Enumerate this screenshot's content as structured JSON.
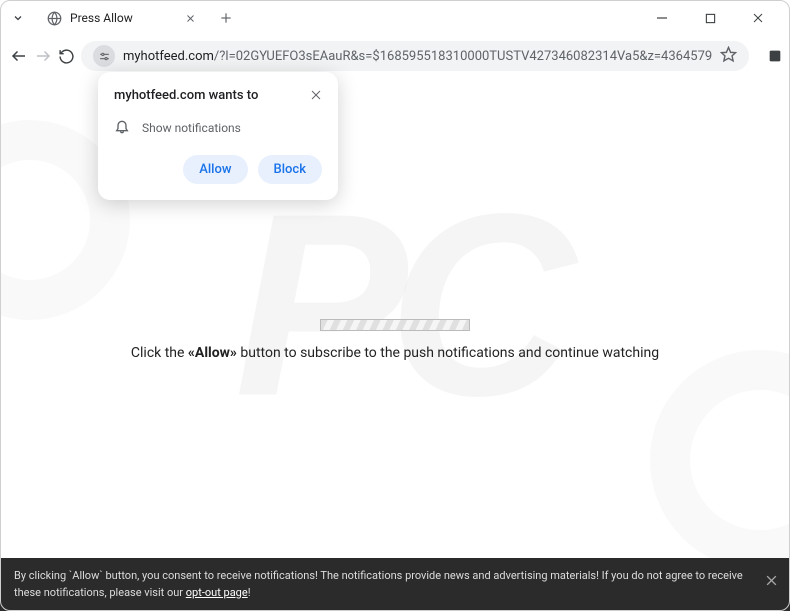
{
  "tab": {
    "title": "Press Allow"
  },
  "url": {
    "domain": "myhotfeed.com",
    "path": "/?l=02GYUEFO3sEAauR&s=$168595518310000TUSTV427346082314Va5&z=4364579"
  },
  "prompt": {
    "title": "myhotfeed.com wants to",
    "permission": "Show notifications",
    "allow": "Allow",
    "block": "Block"
  },
  "page": {
    "instruction_prefix": "Click the ",
    "instruction_bold": "«Allow»",
    "instruction_suffix": " button to subscribe to the push notifications and continue watching"
  },
  "cookiebar": {
    "text_1": "By clicking `Allow` button, you consent to receive notifications! The notifications provide news and advertising materials! If you do not agree to receive these notifications, please visit our ",
    "link": "opt-out page",
    "text_2": "!"
  },
  "watermark": "PC"
}
